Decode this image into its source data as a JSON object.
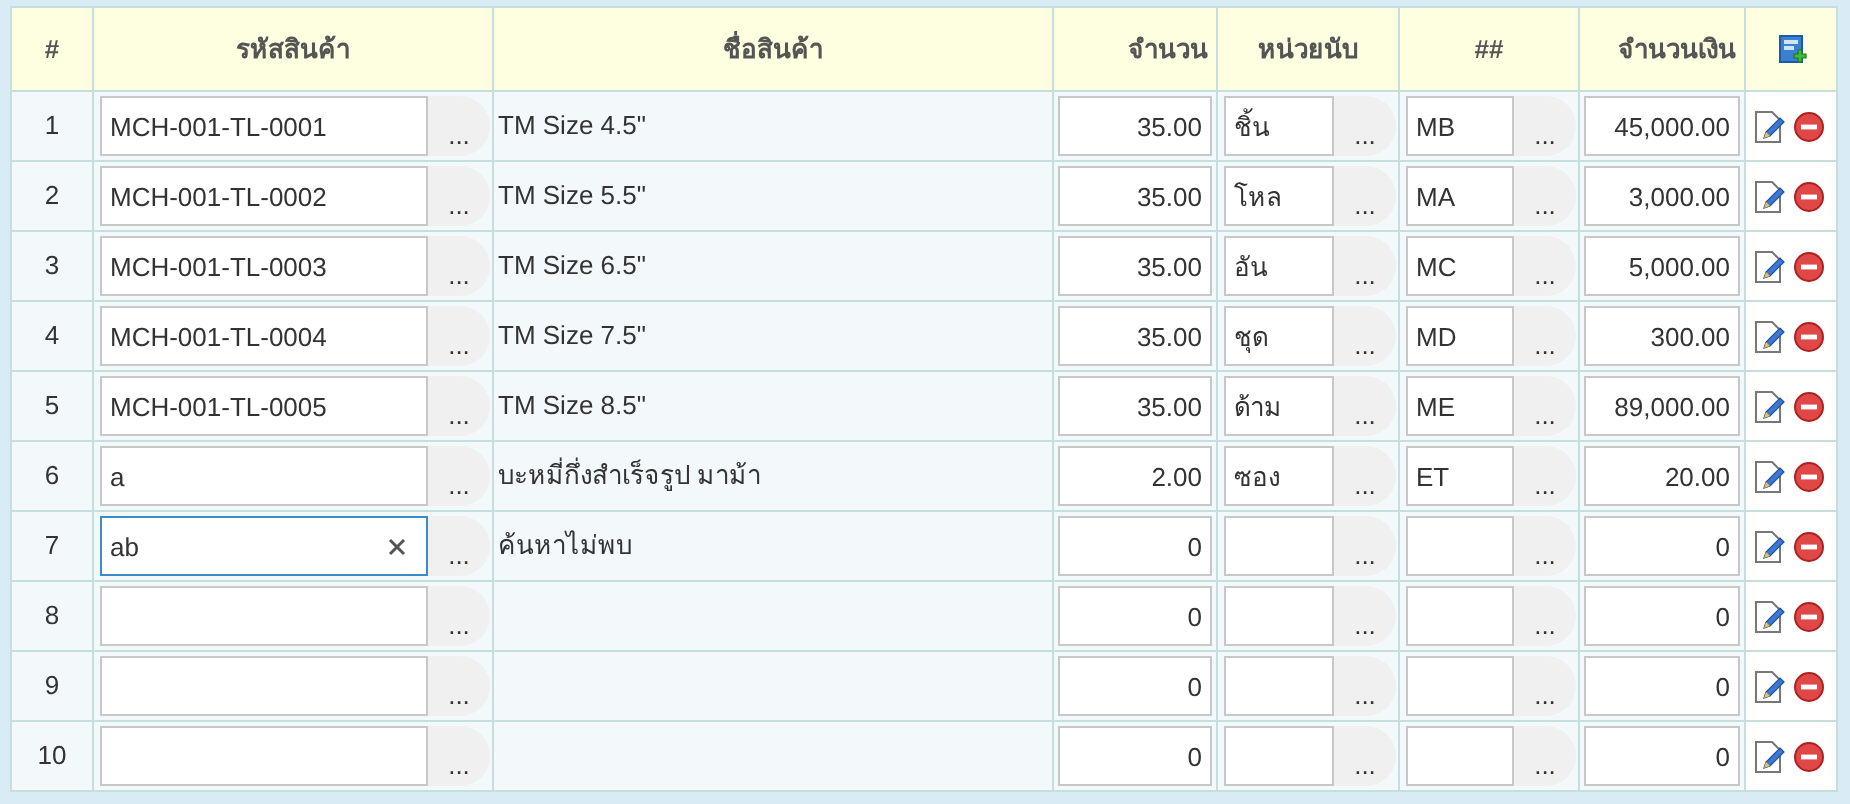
{
  "table": {
    "columns": [
      "#",
      "รหัสสินค้า",
      "ชื่อสินค้า",
      "จำนวน",
      "หน่วยนับ",
      "##",
      "จำนวนเงิน"
    ],
    "rows": [
      {
        "no": "1",
        "code": "MCH-001-TL-0001",
        "name": "TM Size 4.5\"",
        "qty": "35.00",
        "unit": "ชิ้น",
        "account": "MB",
        "amount": "45,000.00",
        "focused": false
      },
      {
        "no": "2",
        "code": "MCH-001-TL-0002",
        "name": "TM Size 5.5\"",
        "qty": "35.00",
        "unit": "โหล",
        "account": "MA",
        "amount": "3,000.00",
        "focused": false
      },
      {
        "no": "3",
        "code": "MCH-001-TL-0003",
        "name": "TM Size 6.5\"",
        "qty": "35.00",
        "unit": "อัน",
        "account": "MC",
        "amount": "5,000.00",
        "focused": false
      },
      {
        "no": "4",
        "code": "MCH-001-TL-0004",
        "name": "TM Size 7.5\"",
        "qty": "35.00",
        "unit": "ชุด",
        "account": "MD",
        "amount": "300.00",
        "focused": false
      },
      {
        "no": "5",
        "code": "MCH-001-TL-0005",
        "name": "TM Size 8.5\"",
        "qty": "35.00",
        "unit": "ด้าม",
        "account": "ME",
        "amount": "89,000.00",
        "focused": false
      },
      {
        "no": "6",
        "code": "a",
        "name": "บะหมี่กึ่งสำเร็จรูป มาม้า",
        "qty": "2.00",
        "unit": "ซอง",
        "account": "ET",
        "amount": "20.00",
        "focused": false
      },
      {
        "no": "7",
        "code": "ab",
        "name": "ค้นหาไม่พบ",
        "qty": "0",
        "amount": "0",
        "focused": true
      },
      {
        "no": "8",
        "qty": "0",
        "amount": "0",
        "focused": false
      },
      {
        "no": "9",
        "qty": "0",
        "amount": "0",
        "focused": false
      },
      {
        "no": "10",
        "qty": "0",
        "amount": "0",
        "focused": false
      }
    ],
    "lookup_label": "..."
  }
}
